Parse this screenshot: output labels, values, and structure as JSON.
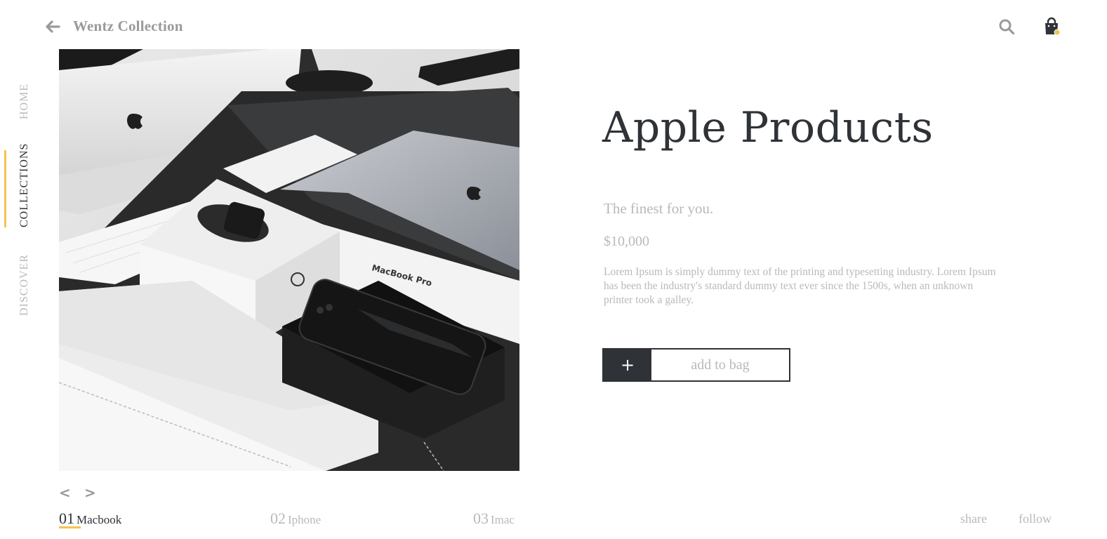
{
  "header": {
    "brand": "Wentz Collection",
    "back_icon": "arrow-left-icon",
    "search_icon": "search-icon",
    "bag_icon": "shopping-bag-icon"
  },
  "nav": {
    "items": [
      {
        "label": "HOME",
        "active": false
      },
      {
        "label": "COLLECTIONS",
        "active": true
      },
      {
        "label": "DISCOVER",
        "active": false
      }
    ]
  },
  "slider": {
    "prev": "<",
    "next": ">",
    "thumbs": [
      {
        "num": "01",
        "name": "Macbook",
        "active": true
      },
      {
        "num": "02",
        "name": "Iphone",
        "active": false
      },
      {
        "num": "03",
        "name": "Imac",
        "active": false
      }
    ]
  },
  "product": {
    "title": "Apple Products",
    "subtitle": "The finest for you.",
    "price": "$10,000",
    "description": "Lorem Ipsum is simply dummy text of the printing and typesetting industry. Lorem Ipsum has been the industry's standard dummy text ever since the 1500s, when an unknown printer took a galley.",
    "add_plus": "+",
    "add_label": "add to bag"
  },
  "footer": {
    "share": "share",
    "follow": "follow"
  },
  "colors": {
    "accent": "#f5c350",
    "dark": "#2f3236",
    "muted": "#b9b9b9"
  }
}
